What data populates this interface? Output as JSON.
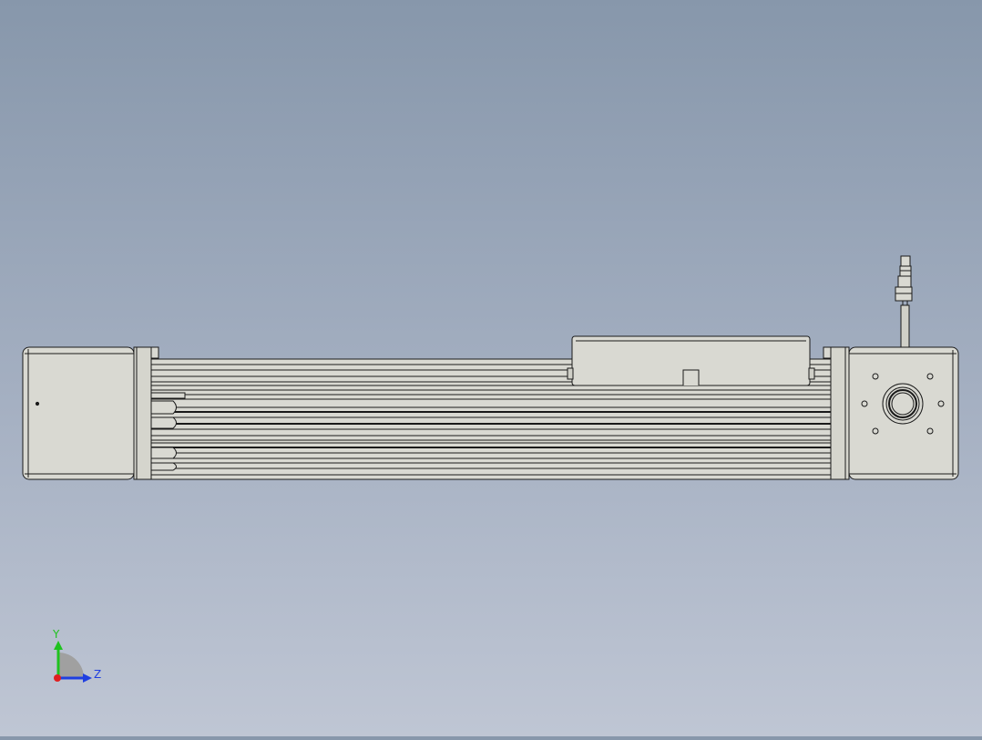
{
  "viewport": {
    "background_top": "#8797ab",
    "background_bottom": "#bfc6d4"
  },
  "model": {
    "part_fill": "#d9d9d2",
    "part_shade": "#c8c8c0",
    "edge_color": "#1a1a1a"
  },
  "triad": {
    "y_label": "Y",
    "z_label": "Z",
    "y_color": "#1fc21f",
    "z_color": "#1f3fe0",
    "x_color": "#e01f1f"
  }
}
